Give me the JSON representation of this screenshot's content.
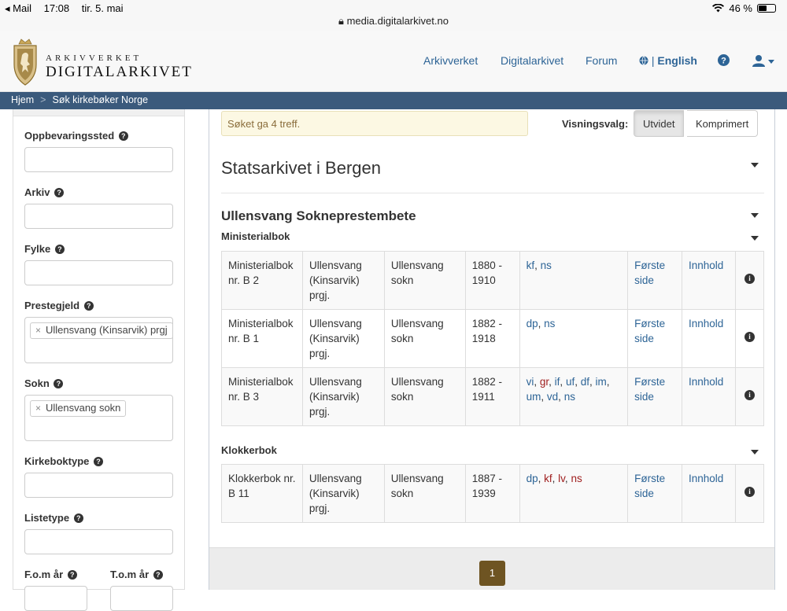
{
  "statusbar": {
    "back": "◂ Mail",
    "time": "17:08",
    "date": "tir. 5. mai",
    "url": "media.digitalarkivet.no",
    "battery": "46 %"
  },
  "header": {
    "logo_top": "ARKIVVERKET",
    "logo_bottom": "DIGITALARKIVET",
    "nav": [
      "Arkivverket",
      "Digitalarkivet",
      "Forum"
    ],
    "language": "English"
  },
  "breadcrumb": [
    "Hjem",
    "Søk kirkebøker Norge"
  ],
  "sidebar": {
    "fields": [
      {
        "label": "Oppbevaringssted",
        "value": ""
      },
      {
        "label": "Arkiv",
        "value": ""
      },
      {
        "label": "Fylke",
        "value": ""
      },
      {
        "label": "Prestegjeld",
        "tag": "Ullensvang (Kinsarvik) prgj"
      },
      {
        "label": "Sokn",
        "tag": "Ullensvang sokn"
      },
      {
        "label": "Kirkeboktype",
        "value": ""
      },
      {
        "label": "Listetype",
        "value": ""
      }
    ],
    "fom": "F.o.m år",
    "tom": "T.o.m år"
  },
  "results": {
    "alert": "Søket ga 4 treff.",
    "view_label": "Visningsvalg:",
    "view_options": [
      "Utvidet",
      "Komprimert"
    ],
    "archive": "Statsarkivet i Bergen",
    "office": "Ullensvang Sokneprestembete",
    "groups": [
      {
        "title": "Ministerialbok",
        "rows": [
          {
            "name": "Ministerialbok nr. B 2",
            "prgj": "Ullensvang (Kinsarvik) prgj.",
            "sokn": "Ullensvang sokn",
            "years": "1880 - 1910",
            "types": [
              {
                "t": "kf",
                "red": false
              },
              {
                "t": "ns",
                "red": false
              }
            ],
            "first": "Første side",
            "content": "Innhold"
          },
          {
            "name": "Ministerialbok nr. B 1",
            "prgj": "Ullensvang (Kinsarvik) prgj.",
            "sokn": "Ullensvang sokn",
            "years": "1882 - 1918",
            "types": [
              {
                "t": "dp",
                "red": false
              },
              {
                "t": "ns",
                "red": false
              }
            ],
            "first": "Første side",
            "content": "Innhold"
          },
          {
            "name": "Ministerialbok nr. B 3",
            "prgj": "Ullensvang (Kinsarvik) prgj.",
            "sokn": "Ullensvang sokn",
            "years": "1882 - 1911",
            "types": [
              {
                "t": "vi",
                "red": false
              },
              {
                "t": "gr",
                "red": true
              },
              {
                "t": "if",
                "red": false
              },
              {
                "t": "uf",
                "red": false
              },
              {
                "t": "df",
                "red": false
              },
              {
                "t": "im",
                "red": false
              },
              {
                "t": "um",
                "red": false
              },
              {
                "t": "vd",
                "red": false
              },
              {
                "t": "ns",
                "red": false
              }
            ],
            "first": "Første side",
            "content": "Innhold"
          }
        ]
      },
      {
        "title": "Klokkerbok",
        "rows": [
          {
            "name": "Klokkerbok nr. B 11",
            "prgj": "Ullensvang (Kinsarvik) prgj.",
            "sokn": "Ullensvang sokn",
            "years": "1887 - 1939",
            "types": [
              {
                "t": "dp",
                "red": false
              },
              {
                "t": "kf",
                "red": true
              },
              {
                "t": "lv",
                "red": true
              },
              {
                "t": "ns",
                "red": true
              }
            ],
            "first": "Første side",
            "content": "Innhold"
          }
        ]
      }
    ],
    "page": "1"
  }
}
